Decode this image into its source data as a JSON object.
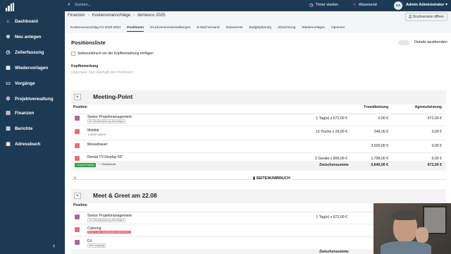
{
  "search": {
    "placeholder": "Suchen..."
  },
  "topbar": {
    "timer": "Timer starten",
    "status": "Abwesend",
    "avatar_initials": "AA",
    "user": "Admin Administrator"
  },
  "sidebar": {
    "items": [
      {
        "label": "Dashboard",
        "icon": "home-icon"
      },
      {
        "label": "Neu anlegen",
        "icon": "plus-circle-icon"
      },
      {
        "label": "Zeiterfassung",
        "icon": "clock-icon"
      },
      {
        "label": "Wiedervorlagen",
        "icon": "calendar-icon"
      },
      {
        "label": "Vorgänge",
        "icon": "folder-icon"
      },
      {
        "label": "Projektverwaltung",
        "icon": "project-icon"
      },
      {
        "label": "Finanzen",
        "icon": "finance-icon"
      },
      {
        "label": "Berichte",
        "icon": "chart-icon"
      },
      {
        "label": "Adressbuch",
        "icon": "addressbook-icon"
      }
    ]
  },
  "breadcrumb": [
    "Finanzen",
    "Kostenvoranschläge",
    "demexco 2025"
  ],
  "print_button": "Druckversion öffnen",
  "tabs": [
    "Kostenvoranschlag KV-2025-0004",
    "Positionen",
    "Druckversionseinstellungen",
    "E-Mail-Versand",
    "Dokumente",
    "Budgetplanung",
    "Abrechnung",
    "Wiedervorlagen",
    "Optionen"
  ],
  "active_tab": "Positionen",
  "positionsliste": {
    "title": "Positionsliste",
    "details_toggle": "Details ausblenden",
    "pagebreak_checkbox": "Seitenumbruch vor der Kopfbemerkung einfügen",
    "kopf_label": "Kopfbemerkung",
    "kopf_placeholder": "Optionaler Text oberhalb der Positionen"
  },
  "columns": {
    "position": "Position",
    "fremd": "Fremdleistung",
    "agentur": "Agenturleistung"
  },
  "sections": [
    {
      "title": "Meeting-Point",
      "rows": [
        {
          "name": "Senior Projektmanagement",
          "sub": "Zur Stundenplanung hinzufügen",
          "sub_style": "tag",
          "qty": "1 Tag(e) x 672,00 €",
          "fremd": "0,00 €",
          "agentur": "672,00 €"
        },
        {
          "name": "Mobilar",
          "sub": "Lorem Ipsum",
          "sub_style": "plain",
          "qty": "12 Tische x 29,00 €",
          "fremd": "348,00 €",
          "agentur": "0,00 €"
        },
        {
          "name": "Messebauer",
          "sub": "",
          "sub_style": "none",
          "qty": "",
          "fremd": "3.500,00 €",
          "agentur": "0,00 €"
        },
        {
          "name": "Rental TV-Display 59\"",
          "sub": "",
          "sub_style": "none",
          "qty": "2 Geräte x 899,00 €",
          "fremd": "1.798,00 €",
          "agentur": "0,00 €"
        }
      ],
      "add_button": "+ Neue Position",
      "sub_button": "+ Teilabschnitt",
      "sum_label": "Zwischensumme",
      "sum_fremd": "5.646,00 €",
      "sum_agentur": "672,00 €"
    },
    {
      "title": "Meet & Greet am 22.08",
      "rows": [
        {
          "name": "Senior Projektmanagement",
          "sub": "Zur Stundenplanung hinzufügen",
          "sub_style": "tag",
          "qty": "1 Tag(e) x 672,00 €",
          "fremd": "",
          "agentur": ""
        },
        {
          "name": "Catering",
          "sub": "Nicht in den Stundenplan übernehmen",
          "sub_style": "red",
          "qty": "",
          "fremd": "",
          "agentur": ""
        },
        {
          "name": "DJ",
          "sub": "Aktiv angelegt",
          "sub_style": "tag",
          "qty": "",
          "fremd": "",
          "agentur": ""
        }
      ],
      "sum_label": "Zwischensumme"
    }
  ],
  "pagebreak_label": "SEITENUMBRUCH"
}
